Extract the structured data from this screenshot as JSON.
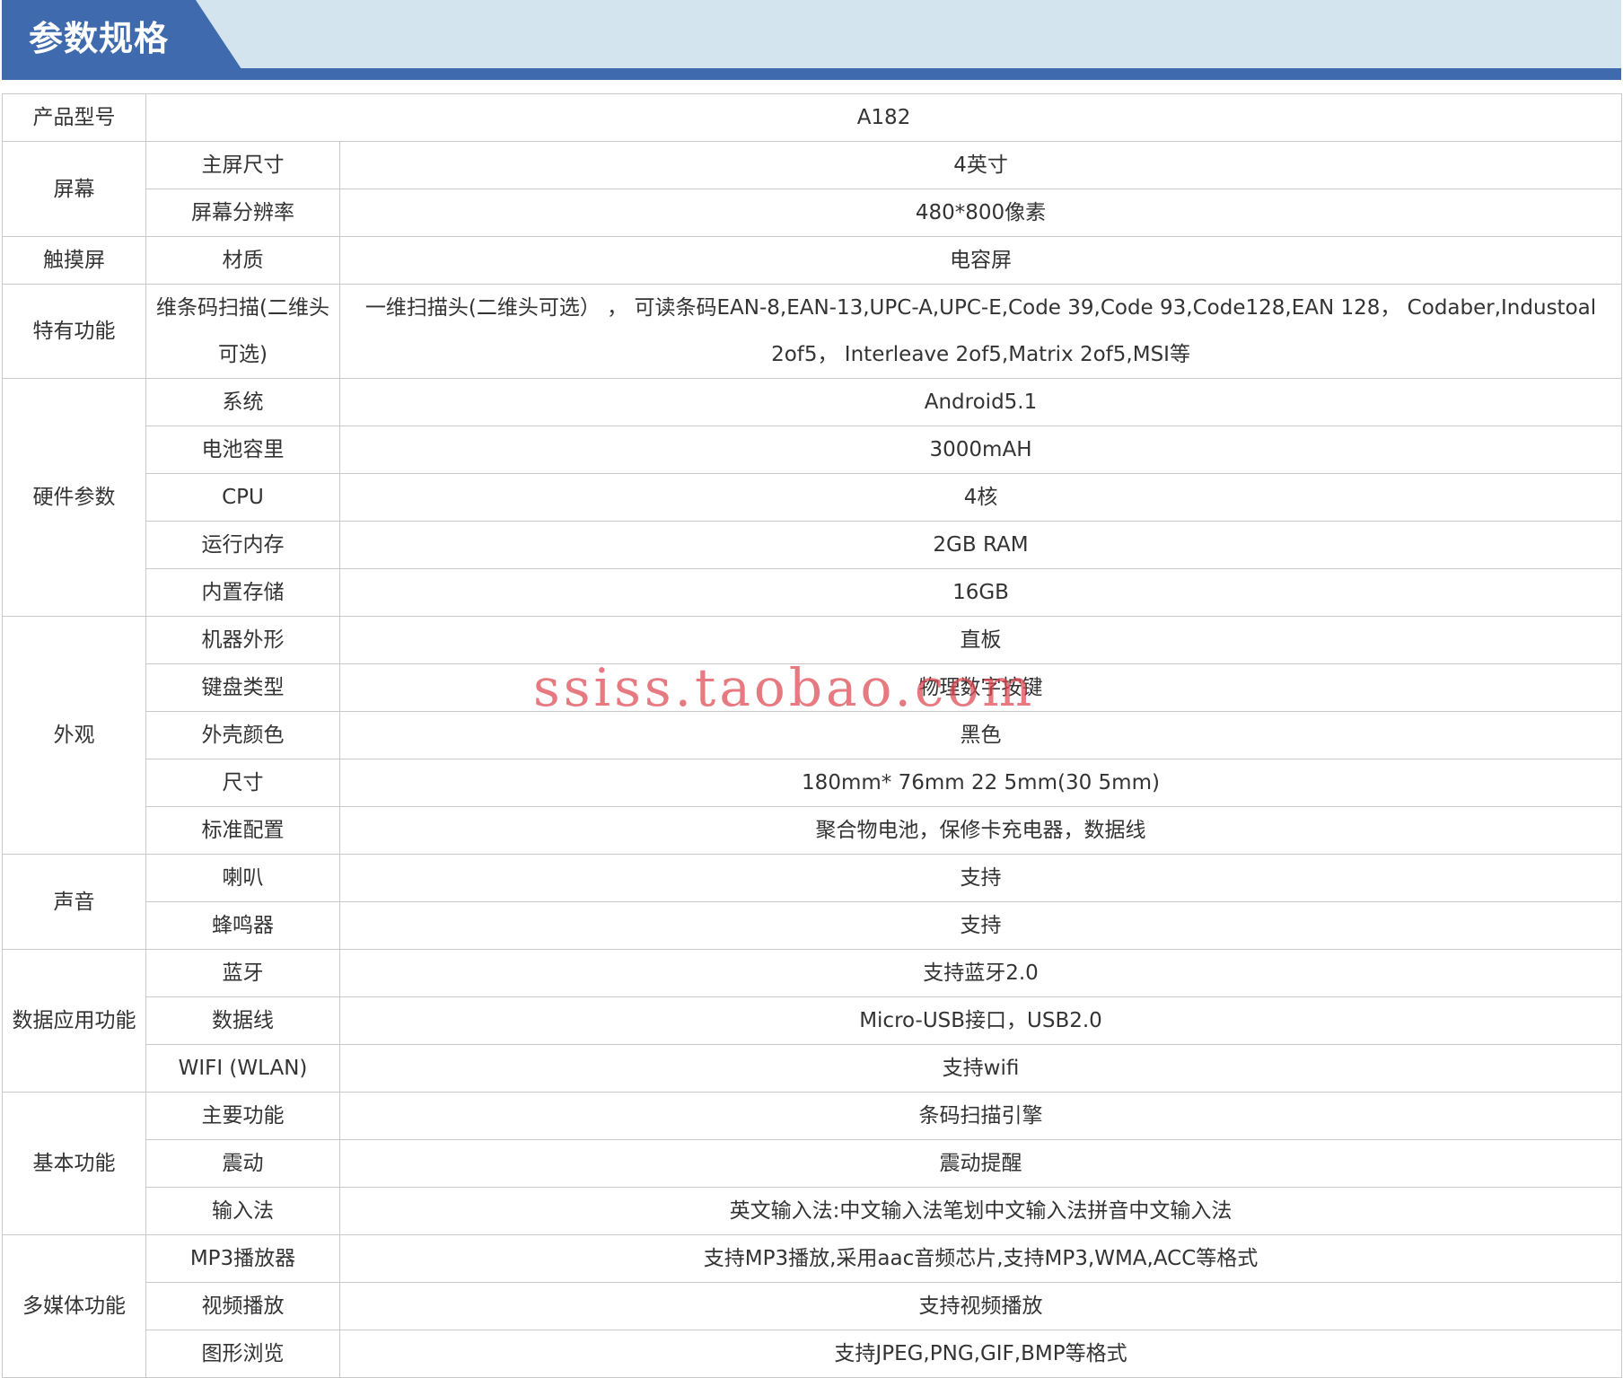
{
  "header": {
    "title": "参数规格"
  },
  "spec": {
    "model": {
      "label": "产品型号",
      "value": "A182"
    },
    "screen": {
      "group": "屏幕",
      "rows": [
        {
          "label": "主屏尺寸",
          "value": "4英寸"
        },
        {
          "label": "屏幕分辨率",
          "value": "480*800像素"
        }
      ]
    },
    "touch": {
      "group": "触摸屏",
      "rows": [
        {
          "label": "材质",
          "value": "电容屏"
        }
      ]
    },
    "special": {
      "group": "特有功能",
      "rows": [
        {
          "label": "维条码扫描(二维头可选)",
          "value": "一维扫描头(二维头可选） ， 可读条码EAN-8,EAN-13,UPC-A,UPC-E,Code 39,Code 93,Code128,EAN 128， Codaber,Industoal 2of5， Interleave 2of5,Matrix 2of5,MSI等"
        }
      ]
    },
    "hardware": {
      "group": "硬件参数",
      "rows": [
        {
          "label": "系统",
          "value": "Android5.1"
        },
        {
          "label": "电池容里",
          "value": "3000mAH"
        },
        {
          "label": "CPU",
          "value": "4核"
        },
        {
          "label": "运行内存",
          "value": "2GB RAM"
        },
        {
          "label": "内置存储",
          "value": "16GB"
        }
      ]
    },
    "appearance": {
      "group": "外观",
      "rows": [
        {
          "label": "机器外形",
          "value": "直板"
        },
        {
          "label": "键盘类型",
          "value": "物理数字按键"
        },
        {
          "label": "外壳颜色",
          "value": "黑色"
        },
        {
          "label": "尺寸",
          "value": "180mm* 76mm 22 5mm(30 5mm)"
        },
        {
          "label": "标准配置",
          "value": "聚合物电池，保修卡充电器，数据线"
        }
      ]
    },
    "sound": {
      "group": "声音",
      "rows": [
        {
          "label": "喇叭",
          "value": "支持"
        },
        {
          "label": "蜂鸣器",
          "value": "支持"
        }
      ]
    },
    "data_app": {
      "group": "数据应用功能",
      "rows": [
        {
          "label": "蓝牙",
          "value": "支持蓝牙2.0"
        },
        {
          "label": "数据线",
          "value": "Micro-USB接口，USB2.0"
        },
        {
          "label": "WIFI (WLAN)",
          "value": "支持wifi"
        }
      ]
    },
    "basic": {
      "group": "基本功能",
      "rows": [
        {
          "label": "主要功能",
          "value": "条码扫描引擎"
        },
        {
          "label": "震动",
          "value": "震动提醒"
        },
        {
          "label": "输入法",
          "value": "英文输入法:中文输入法笔划中文输入法拼音中文输入法"
        }
      ]
    },
    "multimedia": {
      "group": "多媒体功能",
      "rows": [
        {
          "label": "MP3播放器",
          "value": "支持MP3播放,采用aac音频芯片,支持MP3,WMA,ACC等格式"
        },
        {
          "label": "视频播放",
          "value": "支持视频播放"
        },
        {
          "label": "图形浏览",
          "value": "支持JPEG,PNG,GIF,BMP等格式"
        }
      ]
    }
  },
  "watermark": "ssiss.taobao.com"
}
